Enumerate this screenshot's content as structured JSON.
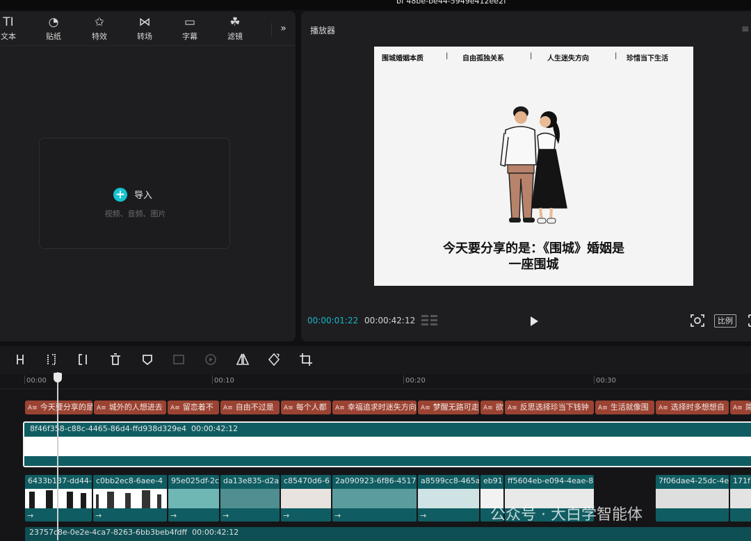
{
  "window": {
    "top_text": "bf 48be-be44-5949e412ee2f"
  },
  "left_toolbar": {
    "tabs": [
      {
        "icon": "TI",
        "label": "文本"
      },
      {
        "icon": "◔",
        "label": "贴纸"
      },
      {
        "icon": "✩",
        "label": "特效"
      },
      {
        "icon": "⋈",
        "label": "转场"
      },
      {
        "icon": "▭",
        "label": "字幕"
      },
      {
        "icon": "☘",
        "label": "滤镜"
      }
    ],
    "more": "»"
  },
  "import_panel": {
    "plus": "+",
    "label": "导入",
    "sub": "视频、音频、图片"
  },
  "player": {
    "title": "播放器",
    "menu": "≡",
    "tabs": [
      "围城婚姻本质",
      "自由孤独关系",
      "人生迷失方向",
      "珍惜当下生活"
    ],
    "caption_line1": "今天要分享的是：《围城》婚姻是",
    "caption_line2": "一座围城",
    "time_current": "00:00:01:22",
    "time_total": "00:00:42:12",
    "ratio_label": "比例",
    "accent": "#1bb6c8"
  },
  "timeline": {
    "ruler": [
      "00:00",
      "00:10",
      "00:20",
      "00:30"
    ],
    "text_icon": "A≡",
    "text_clips": [
      "今天要分享的是",
      "城外的人想进去",
      "留恋着不",
      "自由不过是",
      "每个人都",
      "幸福追求时迷失方向",
      "梦醒无路可走",
      "欲",
      "反思选择珍当下钱钟",
      "生活就像围",
      "选择时多想想自",
      "简"
    ],
    "main_clip": {
      "id": "8f46f358-c88c-4465-86d4-ffd938d329e4",
      "duration": "00:00:42:12"
    },
    "scene_clips": [
      "6433b137-dd44-",
      "c0bb2ec8-6aee-4",
      "95e025df-2c",
      "da13e835-d2a",
      "c85470d6-6",
      "2a090923-6f86-4517",
      "a8599cc8-465a",
      "eb91",
      "ff5604eb-e094-4eae-8",
      "7f06dae4-25dc-4e",
      "171f"
    ],
    "arrow": "→",
    "audio_clip": {
      "id": "23757c8e-0e2e-4ca7-8263-6bb3beb4fdff",
      "duration": "00:00:42:12"
    }
  },
  "watermark": "公众号 · 大白学智能体"
}
